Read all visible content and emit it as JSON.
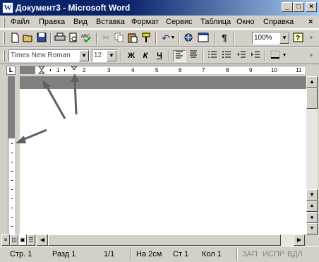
{
  "window": {
    "title": "Документ3 - Microsoft Word",
    "app_icon": "W",
    "controls": {
      "minimize": "_",
      "maximize": "□",
      "close": "×"
    }
  },
  "menu": [
    "Файл",
    "Правка",
    "Вид",
    "Вставка",
    "Формат",
    "Сервис",
    "Таблица",
    "Окно",
    "Справка"
  ],
  "menu_close": "×",
  "standard_toolbar": {
    "zoom": "100%",
    "pilcrow": "¶"
  },
  "format_toolbar": {
    "font_name": "Times New Roman",
    "font_size": "12",
    "bold": "Ж",
    "italic": "К",
    "underline": "Ч"
  },
  "ruler": {
    "tab_selector": "L",
    "numbers": [
      "1",
      "2",
      "3",
      "4",
      "5",
      "6",
      "7",
      "8",
      "9",
      "10",
      "11"
    ]
  },
  "status_bar": {
    "page": "Стр. 1",
    "section": "Разд 1",
    "pages": "1/1",
    "at": "На 2см",
    "line": "Ст 1",
    "column": "Кол 1",
    "rec": "ЗАП",
    "trk": "ИСПР",
    "ext": "ВДЛ"
  },
  "icons": [
    "word-icon",
    "new-doc-icon",
    "open-icon",
    "save-icon",
    "print-icon",
    "print-preview-icon",
    "spelling-icon",
    "cut-icon",
    "copy-icon",
    "paste-icon",
    "format-painter-icon",
    "undo-icon",
    "insert-table-icon",
    "columns-icon",
    "help-icon",
    "align-left-icon",
    "align-center-icon",
    "numbering-icon",
    "bullets-icon",
    "decrease-indent-icon",
    "increase-indent-icon",
    "borders-icon",
    "scroll-up-icon",
    "scroll-down-icon",
    "prev-page-icon",
    "next-page-icon",
    "select-browse-icon",
    "normal-view-icon",
    "web-view-icon",
    "page-view-icon",
    "outline-view-icon",
    "scroll-left-icon",
    "scroll-right-icon",
    "arrow-annotation-icon"
  ]
}
